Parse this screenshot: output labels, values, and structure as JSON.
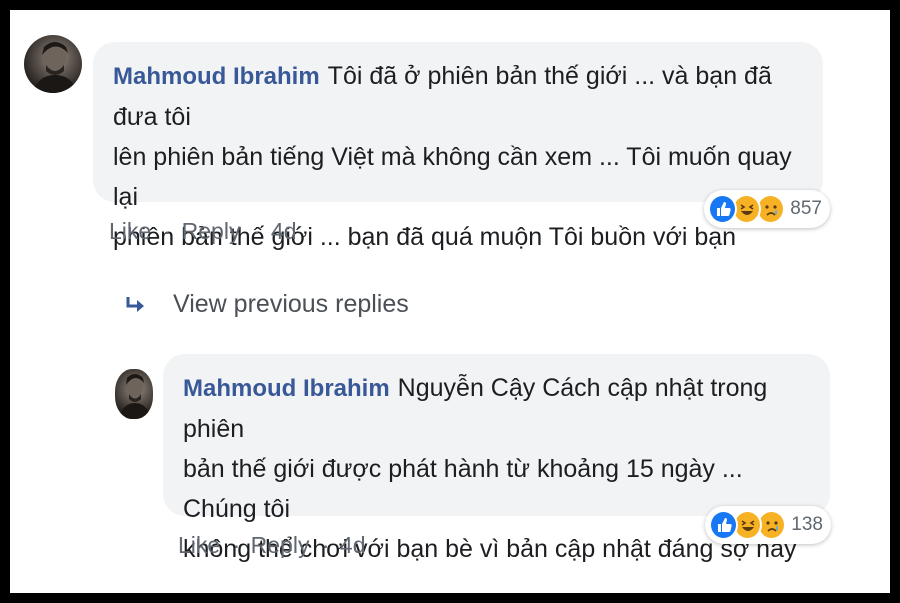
{
  "comment": {
    "author": "Mahmoud Ibrahim",
    "text_lines": [
      "Tôi đã ở phiên bản thế giới ... và bạn đã đưa tôi",
      "lên phiên bản tiếng Việt mà không cần xem ... Tôi muốn quay lại",
      "phiên bản thế giới ... bạn đã quá muộn Tôi buồn với bạn"
    ],
    "reaction_count": "857",
    "actions": {
      "like": "Like",
      "reply": "Reply",
      "time": "4d",
      "dot": "·"
    }
  },
  "view_previous_replies": "View previous replies",
  "reply": {
    "author": "Mahmoud Ibrahim",
    "text_lines": [
      "Nguyễn Cậy Cách cập nhật trong phiên",
      "bản thế giới được phát hành từ khoảng 15 ngày ... Chúng tôi",
      "không thể chơi với bạn bè vì bản cập nhật đáng sợ này"
    ],
    "reaction_count": "138",
    "actions": {
      "like": "Like",
      "reply": "Reply",
      "time": "4d",
      "dot": "·"
    }
  },
  "colors": {
    "author": "#385898",
    "bubble": "#f2f3f5",
    "meta": "#606770",
    "like_blue": "#1877f2",
    "emoji_yellow": "#f7b125"
  },
  "icons": [
    "avatar-photo",
    "like-reaction-icon",
    "haha-reaction-icon",
    "sad-reaction-icon",
    "reply-arrow-icon"
  ]
}
